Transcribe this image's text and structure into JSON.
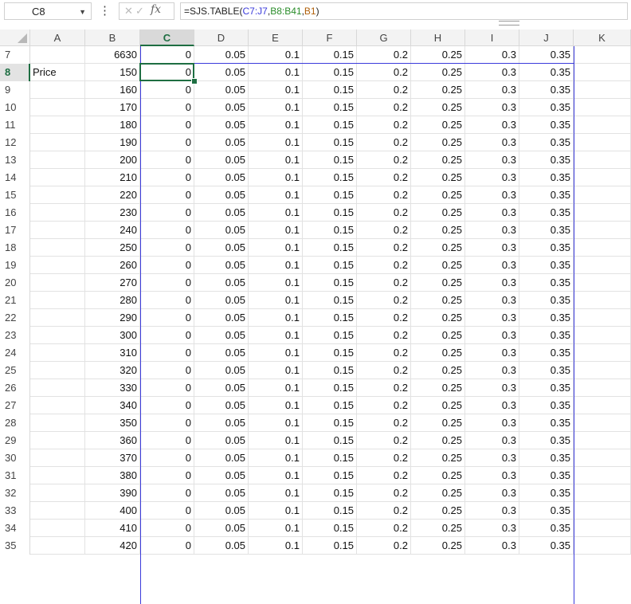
{
  "namebox": {
    "value": "C8"
  },
  "formula": {
    "prefix": "=SJS.TABLE(",
    "ref1": "C7:J7",
    "sep1": ",",
    "ref2": "B8:B41",
    "sep2": ",",
    "ref3": "B1",
    "suffix": ")"
  },
  "colors": {
    "ref1": "#3b3bdb",
    "ref2": "#2a8c2a",
    "ref3": "#b0600a",
    "selection": "#1e6e42"
  },
  "icons": {
    "cancel": "close-icon",
    "confirm": "check-icon",
    "function": "fx-icon",
    "menu": "more-vertical-icon",
    "dropdown": "chevron-down-icon"
  },
  "sheet": {
    "columns": [
      "A",
      "B",
      "C",
      "D",
      "E",
      "F",
      "G",
      "H",
      "I",
      "J",
      "K"
    ],
    "active_column": "C",
    "active_row": "8",
    "rows": [
      {
        "num": "7",
        "cells": [
          "",
          "6630",
          "0",
          "0.05",
          "0.1",
          "0.15",
          "0.2",
          "0.25",
          "0.3",
          "0.35",
          ""
        ]
      },
      {
        "num": "8",
        "cells": [
          "Price",
          "150",
          "0",
          "0.05",
          "0.1",
          "0.15",
          "0.2",
          "0.25",
          "0.3",
          "0.35",
          ""
        ]
      },
      {
        "num": "9",
        "cells": [
          "",
          "160",
          "0",
          "0.05",
          "0.1",
          "0.15",
          "0.2",
          "0.25",
          "0.3",
          "0.35",
          ""
        ]
      },
      {
        "num": "10",
        "cells": [
          "",
          "170",
          "0",
          "0.05",
          "0.1",
          "0.15",
          "0.2",
          "0.25",
          "0.3",
          "0.35",
          ""
        ]
      },
      {
        "num": "11",
        "cells": [
          "",
          "180",
          "0",
          "0.05",
          "0.1",
          "0.15",
          "0.2",
          "0.25",
          "0.3",
          "0.35",
          ""
        ]
      },
      {
        "num": "12",
        "cells": [
          "",
          "190",
          "0",
          "0.05",
          "0.1",
          "0.15",
          "0.2",
          "0.25",
          "0.3",
          "0.35",
          ""
        ]
      },
      {
        "num": "13",
        "cells": [
          "",
          "200",
          "0",
          "0.05",
          "0.1",
          "0.15",
          "0.2",
          "0.25",
          "0.3",
          "0.35",
          ""
        ]
      },
      {
        "num": "14",
        "cells": [
          "",
          "210",
          "0",
          "0.05",
          "0.1",
          "0.15",
          "0.2",
          "0.25",
          "0.3",
          "0.35",
          ""
        ]
      },
      {
        "num": "15",
        "cells": [
          "",
          "220",
          "0",
          "0.05",
          "0.1",
          "0.15",
          "0.2",
          "0.25",
          "0.3",
          "0.35",
          ""
        ]
      },
      {
        "num": "16",
        "cells": [
          "",
          "230",
          "0",
          "0.05",
          "0.1",
          "0.15",
          "0.2",
          "0.25",
          "0.3",
          "0.35",
          ""
        ]
      },
      {
        "num": "17",
        "cells": [
          "",
          "240",
          "0",
          "0.05",
          "0.1",
          "0.15",
          "0.2",
          "0.25",
          "0.3",
          "0.35",
          ""
        ]
      },
      {
        "num": "18",
        "cells": [
          "",
          "250",
          "0",
          "0.05",
          "0.1",
          "0.15",
          "0.2",
          "0.25",
          "0.3",
          "0.35",
          ""
        ]
      },
      {
        "num": "19",
        "cells": [
          "",
          "260",
          "0",
          "0.05",
          "0.1",
          "0.15",
          "0.2",
          "0.25",
          "0.3",
          "0.35",
          ""
        ]
      },
      {
        "num": "20",
        "cells": [
          "",
          "270",
          "0",
          "0.05",
          "0.1",
          "0.15",
          "0.2",
          "0.25",
          "0.3",
          "0.35",
          ""
        ]
      },
      {
        "num": "21",
        "cells": [
          "",
          "280",
          "0",
          "0.05",
          "0.1",
          "0.15",
          "0.2",
          "0.25",
          "0.3",
          "0.35",
          ""
        ]
      },
      {
        "num": "22",
        "cells": [
          "",
          "290",
          "0",
          "0.05",
          "0.1",
          "0.15",
          "0.2",
          "0.25",
          "0.3",
          "0.35",
          ""
        ]
      },
      {
        "num": "23",
        "cells": [
          "",
          "300",
          "0",
          "0.05",
          "0.1",
          "0.15",
          "0.2",
          "0.25",
          "0.3",
          "0.35",
          ""
        ]
      },
      {
        "num": "24",
        "cells": [
          "",
          "310",
          "0",
          "0.05",
          "0.1",
          "0.15",
          "0.2",
          "0.25",
          "0.3",
          "0.35",
          ""
        ]
      },
      {
        "num": "25",
        "cells": [
          "",
          "320",
          "0",
          "0.05",
          "0.1",
          "0.15",
          "0.2",
          "0.25",
          "0.3",
          "0.35",
          ""
        ]
      },
      {
        "num": "26",
        "cells": [
          "",
          "330",
          "0",
          "0.05",
          "0.1",
          "0.15",
          "0.2",
          "0.25",
          "0.3",
          "0.35",
          ""
        ]
      },
      {
        "num": "27",
        "cells": [
          "",
          "340",
          "0",
          "0.05",
          "0.1",
          "0.15",
          "0.2",
          "0.25",
          "0.3",
          "0.35",
          ""
        ]
      },
      {
        "num": "28",
        "cells": [
          "",
          "350",
          "0",
          "0.05",
          "0.1",
          "0.15",
          "0.2",
          "0.25",
          "0.3",
          "0.35",
          ""
        ]
      },
      {
        "num": "29",
        "cells": [
          "",
          "360",
          "0",
          "0.05",
          "0.1",
          "0.15",
          "0.2",
          "0.25",
          "0.3",
          "0.35",
          ""
        ]
      },
      {
        "num": "30",
        "cells": [
          "",
          "370",
          "0",
          "0.05",
          "0.1",
          "0.15",
          "0.2",
          "0.25",
          "0.3",
          "0.35",
          ""
        ]
      },
      {
        "num": "31",
        "cells": [
          "",
          "380",
          "0",
          "0.05",
          "0.1",
          "0.15",
          "0.2",
          "0.25",
          "0.3",
          "0.35",
          ""
        ]
      },
      {
        "num": "32",
        "cells": [
          "",
          "390",
          "0",
          "0.05",
          "0.1",
          "0.15",
          "0.2",
          "0.25",
          "0.3",
          "0.35",
          ""
        ]
      },
      {
        "num": "33",
        "cells": [
          "",
          "400",
          "0",
          "0.05",
          "0.1",
          "0.15",
          "0.2",
          "0.25",
          "0.3",
          "0.35",
          ""
        ]
      },
      {
        "num": "34",
        "cells": [
          "",
          "410",
          "0",
          "0.05",
          "0.1",
          "0.15",
          "0.2",
          "0.25",
          "0.3",
          "0.35",
          ""
        ]
      },
      {
        "num": "35",
        "cells": [
          "",
          "420",
          "0",
          "0.05",
          "0.1",
          "0.15",
          "0.2",
          "0.25",
          "0.3",
          "0.35",
          ""
        ]
      }
    ]
  }
}
